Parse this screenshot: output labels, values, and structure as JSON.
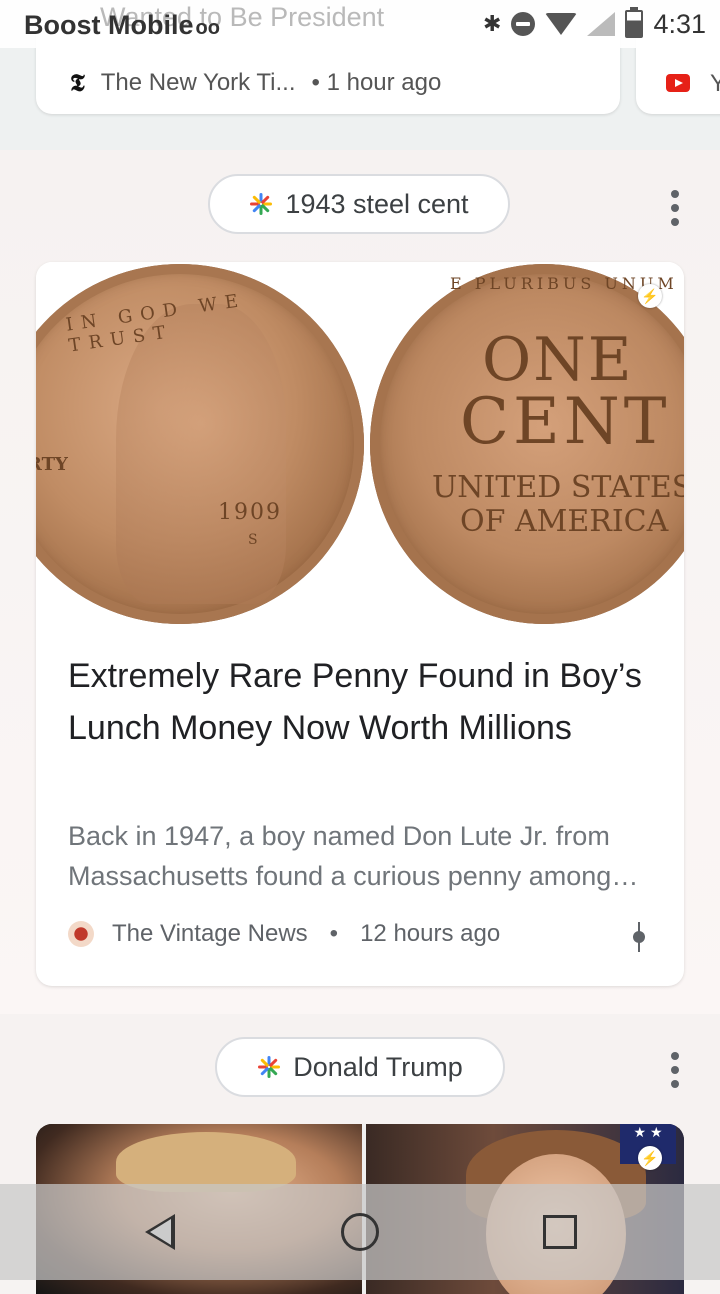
{
  "status_bar": {
    "carrier": "Boost Mobile",
    "voicemail_icon": "voicemail-icon",
    "ghost_notification": "Wanted to Be President",
    "time": "4:31",
    "icons": [
      "bluetooth-icon",
      "dnd-icon",
      "wifi-icon",
      "signal-icon",
      "battery-icon"
    ]
  },
  "prev_card": {
    "source": "The New York Ti...",
    "time": "• 1 hour ago",
    "logo_glyph": "𝕿",
    "next_card_letter": "Y"
  },
  "topic_1": {
    "chip_label": "1943 steel cent",
    "card": {
      "image_text": {
        "front_top": "IN GOD WE TRUST",
        "front_left": "BERTY",
        "front_year": "1909",
        "front_mint": "S",
        "back_top": "E PLURIBUS UNUM",
        "back_one": "ONE",
        "back_cent": "CENT",
        "back_united": "UNITED STATES",
        "back_ofam": "OF AMERICA"
      },
      "headline": "Extremely Rare Penny Found in Boy’s Lunch Money Now Worth Millions",
      "snippet_line1": "Back in 1947, a boy named Don Lute Jr. from",
      "snippet_line2": "Massachusetts found a curious penny among…",
      "source": "The Vintage News",
      "separator": "•",
      "time": "12 hours ago"
    }
  },
  "topic_2": {
    "chip_label": "Donald Trump",
    "flag_glyph": "★ ★"
  },
  "nav": {
    "back": "back-icon",
    "home": "home-icon",
    "recents": "recents-icon"
  },
  "colors": {
    "chip_border": "#dadce0",
    "headline": "#202124",
    "snippet": "#70757a",
    "feed_bg": "#f6f2f1"
  }
}
